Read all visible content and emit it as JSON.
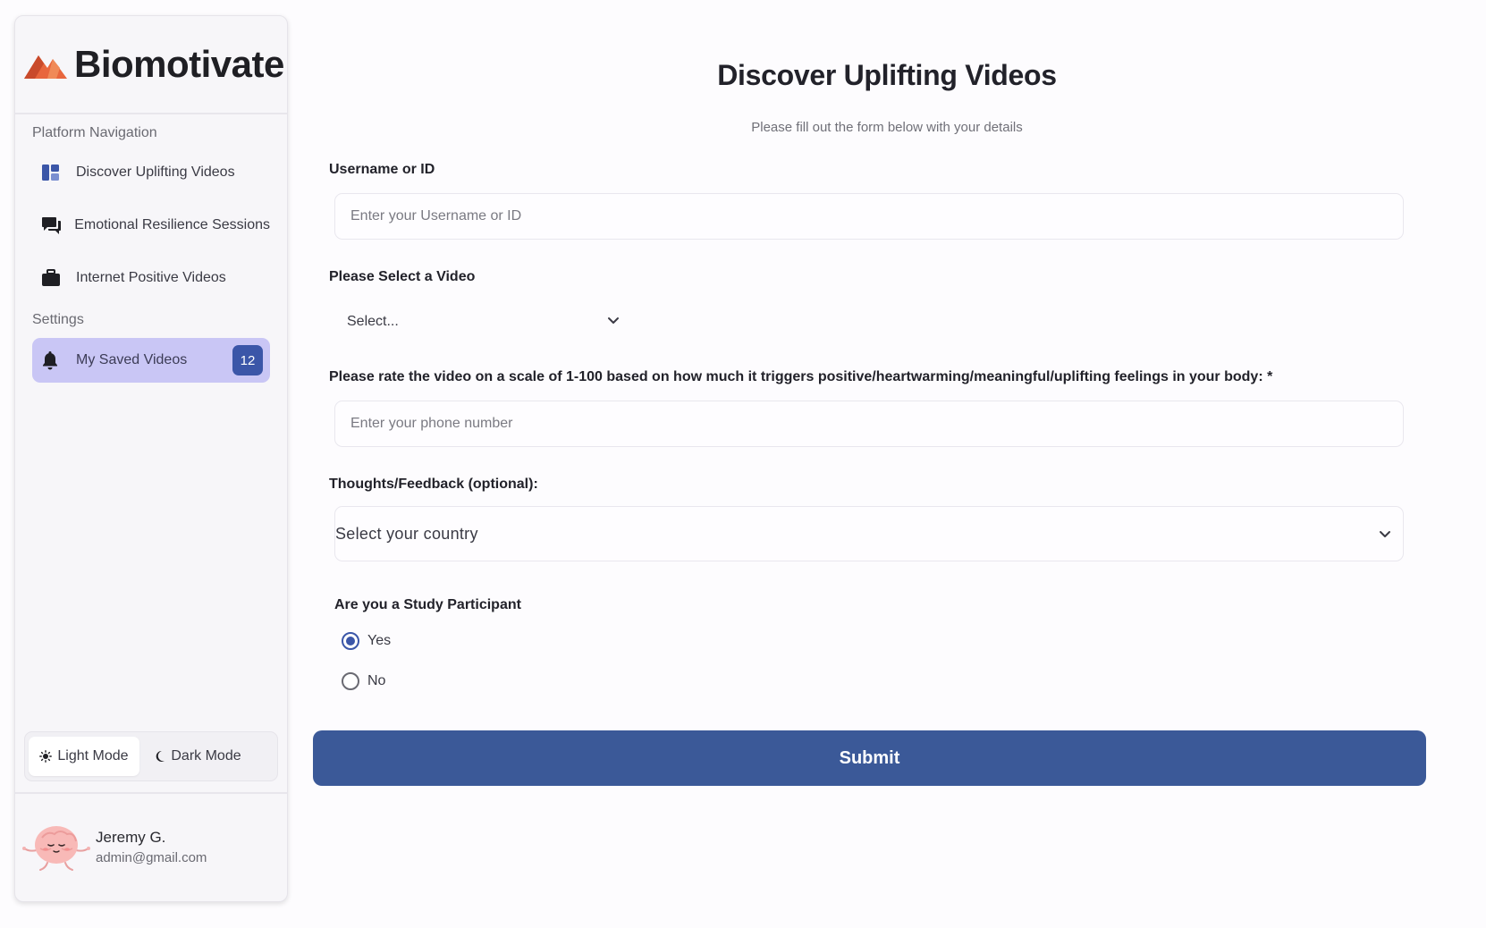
{
  "brand": {
    "name": "Biomotivate"
  },
  "sidebar": {
    "section_nav": "Platform Navigation",
    "section_settings": "Settings",
    "nav_items": [
      {
        "label": "Discover Uplifting Videos",
        "icon": "dashboard-icon"
      },
      {
        "label": "Emotional Resilience Sessions",
        "icon": "chat-icon"
      },
      {
        "label": "Internet Positive Videos",
        "icon": "briefcase-icon"
      }
    ],
    "settings_items": [
      {
        "label": "My Saved Videos",
        "icon": "bell-icon",
        "badge": "12",
        "active": true
      }
    ],
    "mode": {
      "light": "Light Mode",
      "dark": "Dark Mode",
      "selected": "light"
    },
    "user": {
      "name": "Jeremy G.",
      "email": "admin@gmail.com"
    }
  },
  "form": {
    "title": "Discover Uplifting Videos",
    "subtitle": "Please fill out the form below with your details",
    "username_label": "Username or ID",
    "username_placeholder": "Enter your Username or ID",
    "video_label": "Please Select a Video",
    "video_select_value": "Select...",
    "rating_label": "Please rate the video on a scale of 1-100 based on how much it triggers positive/heartwarming/meaningful/uplifting feelings in your body: *",
    "rating_placeholder": "Enter your phone number",
    "feedback_label": "Thoughts/Feedback (optional):",
    "feedback_select_value": "Select your country",
    "participant_label": "Are you a Study Participant",
    "participant_options": [
      {
        "label": "Yes",
        "checked": true
      },
      {
        "label": "No",
        "checked": false
      }
    ],
    "submit_label": "Submit"
  },
  "colors": {
    "accent": "#3b56a8",
    "submit_bg": "#3b5998",
    "active_nav_bg": "#c9c6f5",
    "logo_orange": "#e8663d"
  }
}
